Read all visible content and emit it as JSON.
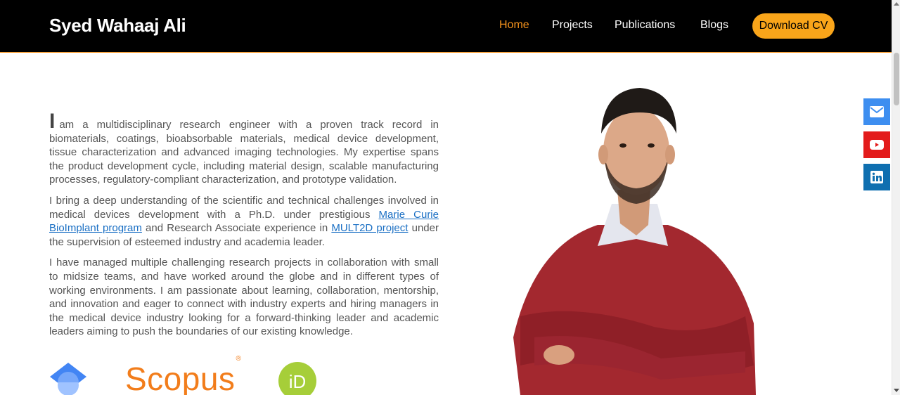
{
  "header": {
    "brand": "Syed Wahaaj Ali",
    "nav": [
      {
        "label": "Home",
        "active": true
      },
      {
        "label": "Projects",
        "active": false
      },
      {
        "label": "Publications",
        "active": false
      },
      {
        "label": "Blogs",
        "active": false
      }
    ],
    "cv_button": "Download CV"
  },
  "intro": {
    "dropcap": "I",
    "p1_rest": "am a multidisciplinary research engineer with a proven track record in biomaterials, coatings, bioabsorbable materials, medical device development, tissue characterization and advanced imaging technologies. My expertise spans the product development cycle, including material design, scalable manufacturing processes, regulatory-compliant characterization, and prototype validation.",
    "p2_before": "I bring a deep understanding of the scientific and technical challenges involved in medical devices development with a Ph.D. under prestigious ",
    "p2_link1": "Marie Curie BioImplant program",
    "p2_middle": " and Research Associate experience in ",
    "p2_link2": "MULT2D project",
    "p2_after": " under the supervision of esteemed industry and academia leader.",
    "p3": "I have managed multiple challenging research projects in collaboration with small to midsize teams, and have worked around the globe and in different types of working environments. I am passionate about learning, collaboration, mentorship, and innovation and eager to connect with industry experts and hiring managers in the medical device industry looking for a forward-thinking leader and academic leaders aiming to push the boundaries of our existing knowledge."
  },
  "profiles": {
    "scholar_icon": "google-scholar-icon",
    "scopus_text": "Scopus",
    "scopus_mark": "®",
    "orcid_text": "iD"
  },
  "social": [
    {
      "icon": "mail-icon",
      "color": "#3d8ef0"
    },
    {
      "icon": "youtube-icon",
      "color": "#e31b1b"
    },
    {
      "icon": "linkedin-icon",
      "color": "#0f6fb0"
    }
  ],
  "colors": {
    "accent": "#f7941d",
    "button": "#f9a51a",
    "link": "#1a6fc4",
    "sweater": "#a3282f"
  }
}
